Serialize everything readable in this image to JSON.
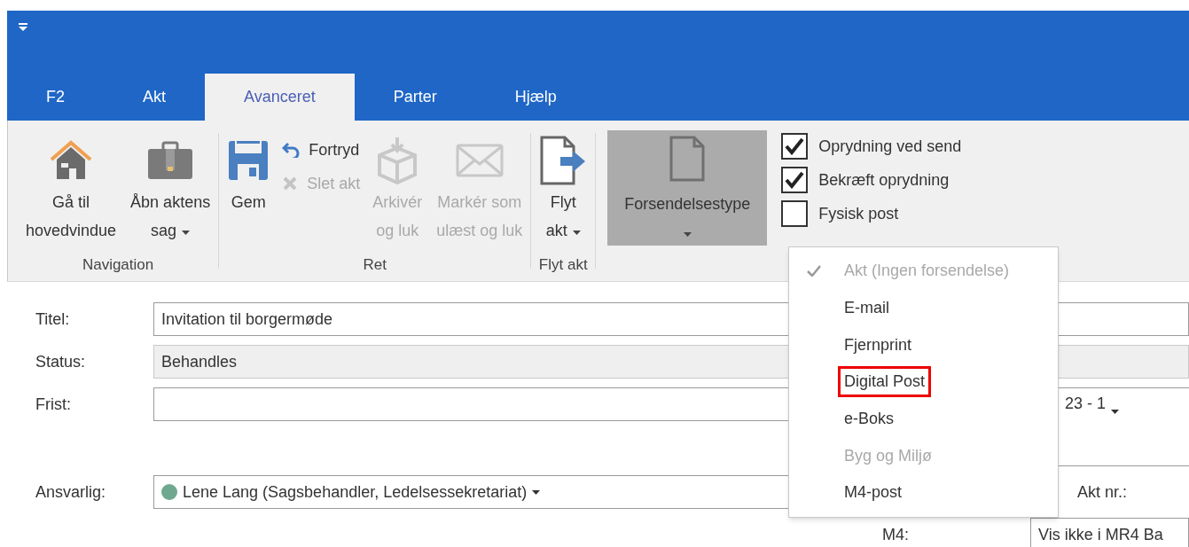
{
  "tabs": [
    {
      "label": "F2",
      "selected": false
    },
    {
      "label": "Akt",
      "selected": false
    },
    {
      "label": "Avanceret",
      "selected": true
    },
    {
      "label": "Parter",
      "selected": false
    },
    {
      "label": "Hjælp",
      "selected": false
    }
  ],
  "ribbon": {
    "groups": [
      {
        "label": "Navigation",
        "items": [
          {
            "kind": "large",
            "label": "Gå til\nhovedvindue",
            "disabled": false,
            "dropdown": false
          },
          {
            "kind": "large",
            "label": "Åbn aktens\nsag",
            "disabled": false,
            "dropdown": true
          }
        ]
      },
      {
        "label": "Ret",
        "items": [
          {
            "kind": "large",
            "label": "Gem",
            "disabled": false,
            "dropdown": false
          },
          {
            "kind": "stack",
            "buttons": [
              {
                "label": "Fortryd",
                "disabled": false
              },
              {
                "label": "Slet akt",
                "disabled": true
              }
            ]
          },
          {
            "kind": "large",
            "label": "Arkivér\nog luk",
            "disabled": true,
            "dropdown": false
          },
          {
            "kind": "large",
            "label": "Markér som\nulæst og luk",
            "disabled": true,
            "dropdown": false
          }
        ]
      },
      {
        "label": "Flyt akt",
        "items": [
          {
            "kind": "large",
            "label": "Flyt\nakt",
            "disabled": false,
            "dropdown": true
          }
        ]
      }
    ],
    "send_type": {
      "label": "Forsendelsestype",
      "expanded": true
    },
    "options": [
      {
        "label": "Oprydning ved send",
        "checked": true
      },
      {
        "label": "Bekræft oprydning",
        "checked": true
      },
      {
        "label": "Fysisk post",
        "checked": false
      }
    ]
  },
  "menu": [
    {
      "label": "Akt (Ingen forsendelse)",
      "selected": true,
      "disabled": true,
      "highlighted": false
    },
    {
      "label": "E-mail",
      "selected": false,
      "disabled": false,
      "highlighted": false
    },
    {
      "label": "Fjernprint",
      "selected": false,
      "disabled": false,
      "highlighted": false
    },
    {
      "label": "Digital Post",
      "selected": false,
      "disabled": false,
      "highlighted": true
    },
    {
      "label": "e-Boks",
      "selected": false,
      "disabled": false,
      "highlighted": false
    },
    {
      "label": "Byg og Miljø",
      "selected": false,
      "disabled": true,
      "highlighted": false
    },
    {
      "label": "M4-post",
      "selected": false,
      "disabled": false,
      "highlighted": false
    }
  ],
  "form": {
    "title": {
      "label": "Titel:",
      "value": "Invitation til borgermøde",
      "disabled": false
    },
    "status": {
      "label": "Status:",
      "value": "Behandles",
      "disabled": true
    },
    "deadline": {
      "label": "Frist:"
    },
    "deadline_side": {
      "value": "23 - 1"
    },
    "responsible": {
      "label": "Ansvarlig:",
      "value": "Lene Lang (Sagsbehandler, Ledelsessekretariat)"
    },
    "act_no": {
      "label": "Akt nr.:"
    },
    "m4": {
      "label": "M4:",
      "value": "Vis ikke i MR4 Ba"
    }
  }
}
